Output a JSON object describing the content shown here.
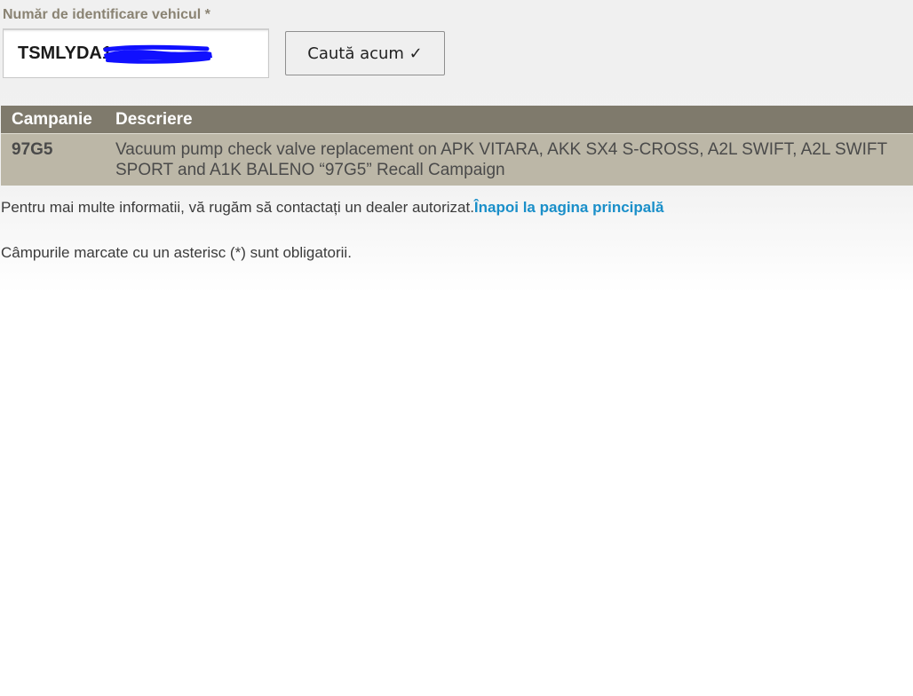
{
  "form": {
    "vin_label": "Număr de identificare vehicul *",
    "vin_value": "TSMLYDA1",
    "search_button": "Caută acum ✓"
  },
  "table": {
    "headers": [
      "Campanie",
      "Descriere"
    ],
    "rows": [
      {
        "code": "97G5",
        "description": "Vacuum pump check valve replacement on APK VITARA, AKK SX4 S-CROSS, A2L SWIFT, A2L SWIFT SPORT and A1K BALENO “97G5” Recall Campaign"
      }
    ]
  },
  "footer": {
    "info_text": "Pentru mai multe informatii, vă rugăm să contactați un dealer autorizat.",
    "home_link": "Înapoi la pagina principală",
    "required_note": "Câmpurile marcate cu un asterisc (*) sunt obligatorii."
  },
  "colors": {
    "header_bg": "#7f7a6c",
    "row_bg": "#bcb7a7",
    "link": "#1a8fc9",
    "label": "#8a8373",
    "redaction": "#1010ff"
  }
}
